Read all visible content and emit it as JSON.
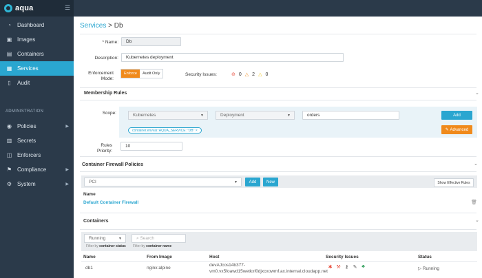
{
  "app": {
    "name": "aqua"
  },
  "sidebar": {
    "items": [
      {
        "label": "Dashboard",
        "icon": "clock-icon"
      },
      {
        "label": "Images",
        "icon": "images-icon"
      },
      {
        "label": "Containers",
        "icon": "containers-icon"
      },
      {
        "label": "Services",
        "icon": "services-icon",
        "active": true
      },
      {
        "label": "Audit",
        "icon": "audit-icon"
      }
    ],
    "admin_title": "ADMINISTRATION",
    "admin_items": [
      {
        "label": "Policies",
        "icon": "policies-icon"
      },
      {
        "label": "Secrets",
        "icon": "secrets-icon"
      },
      {
        "label": "Enforcers",
        "icon": "enforcers-icon"
      },
      {
        "label": "Compliance",
        "icon": "compliance-icon"
      },
      {
        "label": "System",
        "icon": "system-icon"
      }
    ]
  },
  "breadcrumb": {
    "parent": "Services",
    "separator": ">",
    "current": "Db"
  },
  "form": {
    "name_label": "* Name:",
    "name_value": "Db",
    "description_label": "Description:",
    "description_value": "Kubernetes deployment",
    "enforcement_label": "Enforcement Mode:",
    "enforce_label": "Enforce",
    "audit_only_label": "Audit Only",
    "enforcement_selected": "Enforce",
    "security_issues_label": "Security Issues:",
    "security_issues": {
      "high": "0",
      "medium": "2",
      "low": "0"
    }
  },
  "membership": {
    "title": "Membership Rules",
    "scope_label": "Scope:",
    "scope_type": "Kubernetes",
    "scope_object": "Deployment",
    "scope_value": "orders",
    "add_label": "Add",
    "rule_pill": "container.envvar.'AQUA_SERVICE'.\"DB\"",
    "advanced_label": "Advanced",
    "priority_label": "Rules Priority:",
    "priority_value": "10"
  },
  "firewall": {
    "title": "Container Firewall Policies",
    "select_value": "PCI",
    "add_label": "Add",
    "new_label": "New",
    "show_effective_label": "Show Effective Rules",
    "name_header": "Name",
    "policies": [
      {
        "name": "Default Container Firewall"
      }
    ]
  },
  "containers": {
    "title": "Containers",
    "status_filter": "Running",
    "search_placeholder": "Search",
    "filter_status_hint_prefix": "Filter by ",
    "filter_status_hint_bold": "container status",
    "filter_name_hint_prefix": "Filter by ",
    "filter_name_hint_bold": "container name",
    "columns": [
      "Name",
      "From Image",
      "Host",
      "Security Issues",
      "Status"
    ],
    "rows": [
      {
        "name": "db1",
        "image": "nginx:alpine",
        "host_line1": "devAJcos14b377-",
        "host_line2": "vm0.vx5foawd15wetkxf0djxcxowmf.ax.internal.cloudapp.net",
        "status": "Running"
      }
    ]
  },
  "colors": {
    "accent": "#2aa6d0",
    "orange": "#f08a1c",
    "sidebar": "#2b3a4a"
  }
}
